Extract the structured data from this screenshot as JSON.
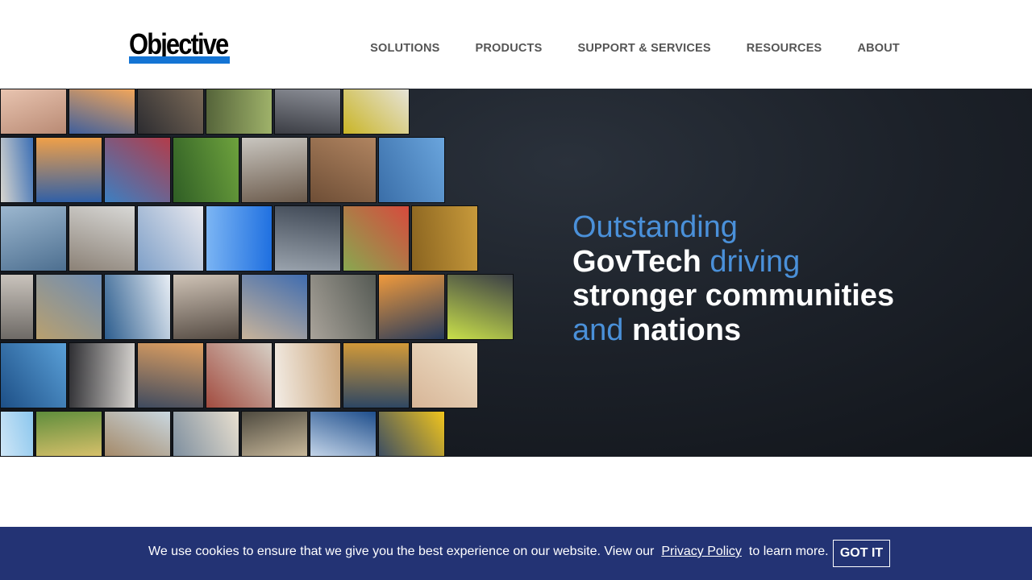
{
  "brand": {
    "logo_text": "Objective",
    "accent": "#1474d4"
  },
  "nav": {
    "items": [
      {
        "label": "SOLUTIONS"
      },
      {
        "label": "PRODUCTS"
      },
      {
        "label": "SUPPORT & SERVICES"
      },
      {
        "label": "RESOURCES"
      },
      {
        "label": "ABOUT"
      }
    ]
  },
  "hero": {
    "headline": {
      "line1": "Outstanding",
      "line2_bold": "GovTech",
      "line2_light": " driving",
      "line3": "stronger communities",
      "line4_light": "and ",
      "line4_bold": "nations"
    },
    "highlight_color": "#4a90d9",
    "photo_tiles": [
      "hands",
      "airplane",
      "highway",
      "garden",
      "commuters",
      "hi-vis worker",
      "drone",
      "power lines",
      "fishing nets",
      "cyclists",
      "colleagues",
      "construction scaffold",
      "transporter bridge",
      "pier",
      "rope",
      "hospital",
      "aircraft",
      "office workers",
      "surveyor",
      "wheat field",
      "elderly woman",
      "parliament house",
      "ferry",
      "cafe",
      "house",
      "soldiers",
      "city sunset",
      "police",
      "surgeon",
      "businesswoman",
      "pylon sunset",
      "street",
      "girl on swing",
      "engineer",
      "holding hands",
      "glacier",
      "lake",
      "beach",
      "cyclist",
      "officers",
      "skyscraper",
      "train",
      "mountains"
    ]
  },
  "cookie": {
    "text_before": "We use cookies to ensure that we give you the best experience on our website. View our",
    "link": "Privacy Policy",
    "text_after": "to learn more.",
    "button": "GOT IT",
    "background": "#233374"
  }
}
